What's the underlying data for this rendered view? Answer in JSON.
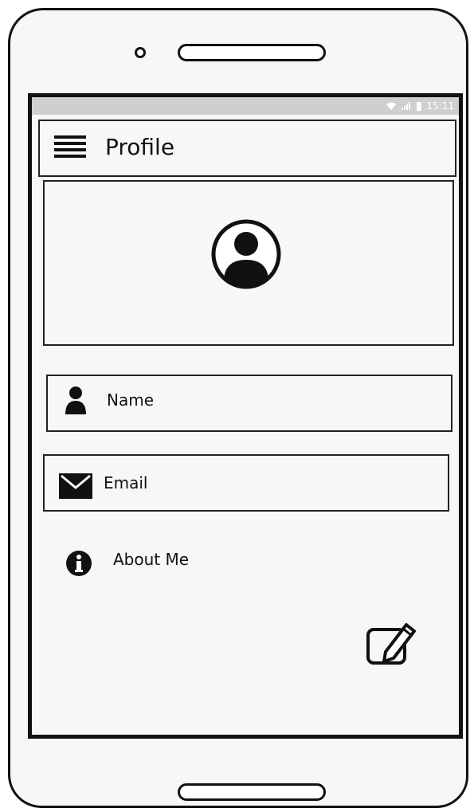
{
  "status_bar": {
    "time": "15:11",
    "icons": [
      "wifi-icon",
      "signal-icon",
      "battery-icon"
    ]
  },
  "app_bar": {
    "title": "Profile",
    "menu_icon": "hamburger-menu-icon"
  },
  "profile": {
    "avatar_icon": "user-circle-icon"
  },
  "fields": {
    "name": {
      "label": "Name",
      "icon": "person-icon"
    },
    "email": {
      "label": "Email",
      "icon": "envelope-icon"
    },
    "about": {
      "label": "About Me",
      "icon": "info-icon"
    }
  },
  "actions": {
    "edit_icon": "edit-icon"
  },
  "colors": {
    "ink": "#111111",
    "status_bar": "#cfcfcf",
    "screen": "#f7f7f7"
  }
}
